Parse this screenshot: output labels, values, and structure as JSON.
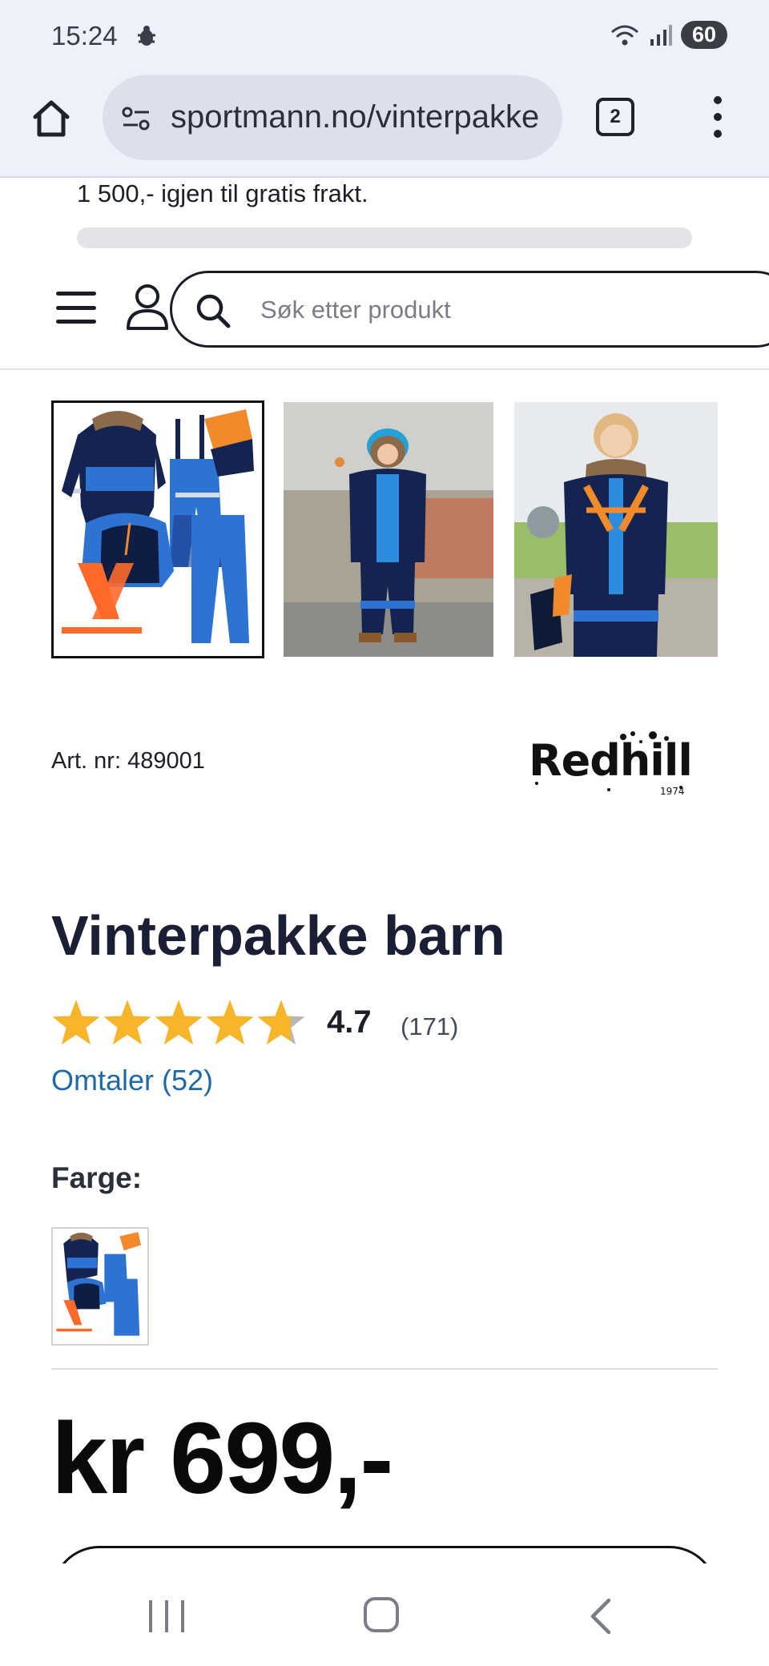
{
  "status_bar": {
    "time": "15:24",
    "battery": "60",
    "icons": [
      "bug-notification-icon",
      "wifi-icon",
      "signal-icon"
    ]
  },
  "browser": {
    "url": "sportmann.no/vinterpakke",
    "tab_count": "2",
    "icons": [
      "home-icon",
      "site-settings-icon",
      "more-menu-icon"
    ]
  },
  "shipping": {
    "text": "1 500,- igjen til gratis frakt.",
    "progress": 0
  },
  "header": {
    "search_placeholder": "Søk etter produkt",
    "icons": [
      "menu-icon",
      "user-icon",
      "search-icon"
    ]
  },
  "product": {
    "art_label": "Art. nr:",
    "art_number": "489001",
    "brand": "Redhill",
    "brand_year": "1974",
    "title": "Vinterpakke barn",
    "rating": "4.7",
    "rating_value": 4.7,
    "rating_max": 5,
    "rating_count": "(171)",
    "reviews_link": "Omtaler (52)",
    "color_label": "Farge:",
    "price": "kr 699,-"
  },
  "colors": {
    "navy": "#14234f",
    "blue": "#2c73d2",
    "orange": "#f08a2a",
    "link": "#1f6aa5",
    "star": "#f7b52c",
    "star_empty": "#b8b8b8"
  }
}
